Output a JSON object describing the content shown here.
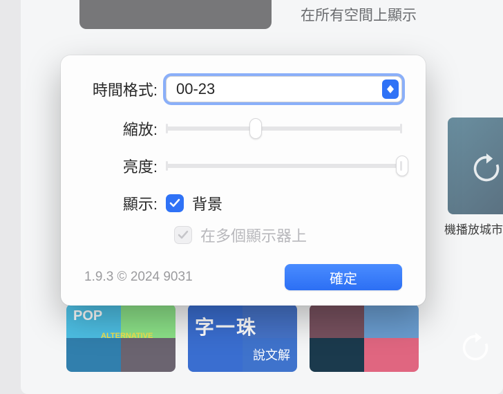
{
  "background": {
    "menu_item": "在所有空間上顯示",
    "side_caption": "機播放城市",
    "thumb2_text": "字一珠",
    "thumb2_sub": "說文解",
    "thumb1_pop": "POP",
    "thumb1_alt": "ALTERNATIVE"
  },
  "dialog": {
    "labels": {
      "time_format": "時間格式:",
      "scale": "縮放:",
      "brightness": "亮度:",
      "display": "顯示:"
    },
    "time_format": {
      "value": "00-23"
    },
    "scale": {
      "percent": 38
    },
    "brightness": {
      "percent": 100
    },
    "checkboxes": {
      "background": {
        "label": "背景",
        "checked": true
      },
      "multi_display": {
        "label": "在多個顯示器上",
        "checked": true,
        "disabled": true
      }
    },
    "version": "1.9.3 © 2024 9031",
    "ok": "確定"
  }
}
